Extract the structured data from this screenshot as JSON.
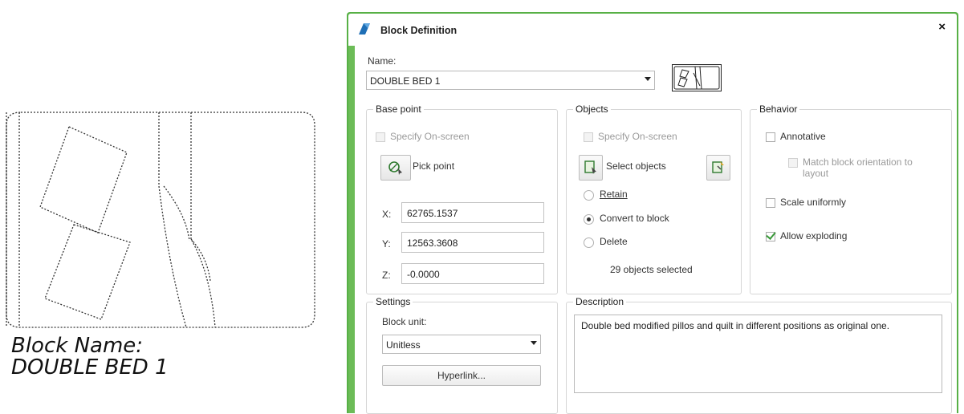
{
  "drawing": {
    "caption_line1": "Block Name:",
    "caption_line2": "DOUBLE BED 1"
  },
  "dialog": {
    "title": "Block Definition",
    "close_glyph": "×",
    "name_label": "Name:",
    "name_value": "DOUBLE BED 1",
    "base_point": {
      "title": "Base point",
      "specify_on_screen": "Specify On-screen",
      "specify_checked": false,
      "pick_point": "Pick point",
      "x_label": "X:",
      "x_value": "62765.1537",
      "y_label": "Y:",
      "y_value": "12563.3608",
      "z_label": "Z:",
      "z_value": "-0.0000"
    },
    "objects": {
      "title": "Objects",
      "specify_on_screen": "Specify On-screen",
      "specify_checked": false,
      "select_objects": "Select objects",
      "retain": "Retain",
      "convert_to_block": "Convert to block",
      "delete": "Delete",
      "selected_option": "convert_to_block",
      "status": "29 objects selected"
    },
    "behavior": {
      "title": "Behavior",
      "annotative": "Annotative",
      "annotative_checked": false,
      "match_orientation": "Match block orientation to layout",
      "match_checked": false,
      "scale_uniformly": "Scale uniformly",
      "scale_checked": false,
      "allow_exploding": "Allow exploding",
      "allow_checked": true
    },
    "settings": {
      "title": "Settings",
      "block_unit_label": "Block unit:",
      "block_unit_value": "Unitless",
      "hyperlink": "Hyperlink..."
    },
    "description": {
      "title": "Description",
      "text": "Double bed modified pillos and quilt in different positions as original one."
    }
  },
  "colors": {
    "window_border": "#57b046",
    "check_mark": "#3a9a3a"
  }
}
